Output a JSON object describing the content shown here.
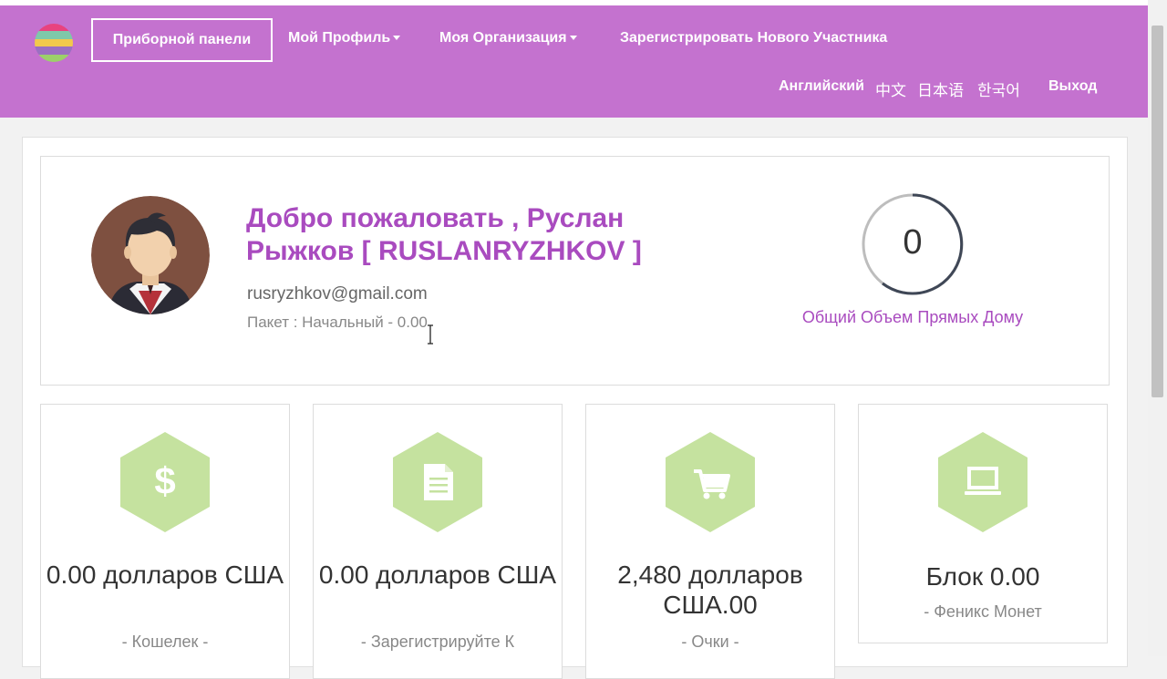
{
  "nav": {
    "dashboard": "Приборной панели",
    "profile": "Мой Профиль",
    "organization": "Моя Организация",
    "register": "Зарегистрировать Нового Участника",
    "languages": [
      "Английский",
      "中文",
      "日本语",
      "한국어"
    ],
    "logout": "Выход"
  },
  "welcome": {
    "title": "Добро пожаловать , Руслан Рыжков [ RUSLANRYZHKOV ]",
    "email": "rusryzhkov@gmail.com",
    "package": "Пакет : Начальный - 0.00"
  },
  "direct_volume": {
    "value": "0",
    "label": "Общий Объем Прямых Дому"
  },
  "stats": [
    {
      "icon": "dollar-icon",
      "value": "0.00 долларов США",
      "label": "- Кошелек -"
    },
    {
      "icon": "document-icon",
      "value": "0.00 долларов США",
      "label": "- Зарегистрируйте К"
    },
    {
      "icon": "cart-icon",
      "value": "2,480 долларов США.00",
      "label": "- Очки -"
    },
    {
      "icon": "laptop-icon",
      "value": "Блок 0.00",
      "label": "- Феникс Монет"
    }
  ],
  "colors": {
    "navbar": "#c472cf",
    "accent": "#a94bbf",
    "hexagon": "#c5e29f"
  }
}
